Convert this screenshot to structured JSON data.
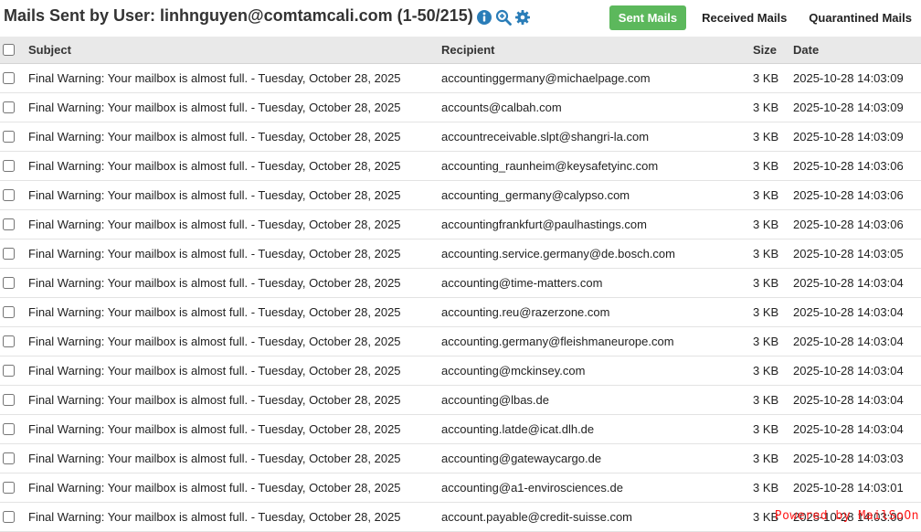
{
  "header": {
    "title": "Mails Sent by User: linhnguyen@comtamcali.com (1-50/215)",
    "icons": [
      "info-icon",
      "zoom-in-icon",
      "gear-icon"
    ],
    "tabs": [
      {
        "label": "Sent Mails",
        "active": true
      },
      {
        "label": "Received Mails",
        "active": false
      },
      {
        "label": "Quarantined Mails",
        "active": false
      }
    ]
  },
  "colors": {
    "accent_green": "#5cb85c",
    "icon_blue": "#2a7db8",
    "header_bg": "#e9e9e9",
    "powered_red": "#ff1a1a"
  },
  "table": {
    "columns": {
      "subject": "Subject",
      "recipient": "Recipient",
      "size": "Size",
      "date": "Date"
    },
    "rows": [
      {
        "subject": "Final Warning: Your mailbox is almost full. - Tuesday, October 28, 2025",
        "recipient": "accountinggermany@michaelpage.com",
        "size": "3 KB",
        "date": "2025-10-28 14:03:09"
      },
      {
        "subject": "Final Warning: Your mailbox is almost full. - Tuesday, October 28, 2025",
        "recipient": "accounts@calbah.com",
        "size": "3 KB",
        "date": "2025-10-28 14:03:09"
      },
      {
        "subject": "Final Warning: Your mailbox is almost full. - Tuesday, October 28, 2025",
        "recipient": "accountreceivable.slpt@shangri-la.com",
        "size": "3 KB",
        "date": "2025-10-28 14:03:09"
      },
      {
        "subject": "Final Warning: Your mailbox is almost full. - Tuesday, October 28, 2025",
        "recipient": "accounting_raunheim@keysafetyinc.com",
        "size": "3 KB",
        "date": "2025-10-28 14:03:06"
      },
      {
        "subject": "Final Warning: Your mailbox is almost full. - Tuesday, October 28, 2025",
        "recipient": "accounting_germany@calypso.com",
        "size": "3 KB",
        "date": "2025-10-28 14:03:06"
      },
      {
        "subject": "Final Warning: Your mailbox is almost full. - Tuesday, October 28, 2025",
        "recipient": "accountingfrankfurt@paulhastings.com",
        "size": "3 KB",
        "date": "2025-10-28 14:03:06"
      },
      {
        "subject": "Final Warning: Your mailbox is almost full. - Tuesday, October 28, 2025",
        "recipient": "accounting.service.germany@de.bosch.com",
        "size": "3 KB",
        "date": "2025-10-28 14:03:05"
      },
      {
        "subject": "Final Warning: Your mailbox is almost full. - Tuesday, October 28, 2025",
        "recipient": "accounting@time-matters.com",
        "size": "3 KB",
        "date": "2025-10-28 14:03:04"
      },
      {
        "subject": "Final Warning: Your mailbox is almost full. - Tuesday, October 28, 2025",
        "recipient": "accounting.reu@razerzone.com",
        "size": "3 KB",
        "date": "2025-10-28 14:03:04"
      },
      {
        "subject": "Final Warning: Your mailbox is almost full. - Tuesday, October 28, 2025",
        "recipient": "accounting.germany@fleishmaneurope.com",
        "size": "3 KB",
        "date": "2025-10-28 14:03:04"
      },
      {
        "subject": "Final Warning: Your mailbox is almost full. - Tuesday, October 28, 2025",
        "recipient": "accounting@mckinsey.com",
        "size": "3 KB",
        "date": "2025-10-28 14:03:04"
      },
      {
        "subject": "Final Warning: Your mailbox is almost full. - Tuesday, October 28, 2025",
        "recipient": "accounting@lbas.de",
        "size": "3 KB",
        "date": "2025-10-28 14:03:04"
      },
      {
        "subject": "Final Warning: Your mailbox is almost full. - Tuesday, October 28, 2025",
        "recipient": "accounting.latde@icat.dlh.de",
        "size": "3 KB",
        "date": "2025-10-28 14:03:04"
      },
      {
        "subject": "Final Warning: Your mailbox is almost full. - Tuesday, October 28, 2025",
        "recipient": "accounting@gatewaycargo.de",
        "size": "3 KB",
        "date": "2025-10-28 14:03:03"
      },
      {
        "subject": "Final Warning: Your mailbox is almost full. - Tuesday, October 28, 2025",
        "recipient": "accounting@a1-envirosciences.de",
        "size": "3 KB",
        "date": "2025-10-28 14:03:01"
      },
      {
        "subject": "Final Warning: Your mailbox is almost full. - Tuesday, October 28, 2025",
        "recipient": "account.payable@credit-suisse.com",
        "size": "3 KB",
        "date": "2025-10-28 14:03:00"
      }
    ]
  },
  "footer": {
    "powered_by": "Powered by MailSoOn"
  }
}
